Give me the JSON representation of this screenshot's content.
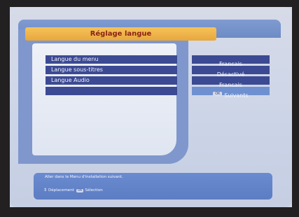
{
  "title": "Réglage langue",
  "menu": [
    {
      "label": "Langue du menu"
    },
    {
      "label": "Langue sous-titres"
    },
    {
      "label": "Langue Audio"
    },
    {
      "label": ""
    }
  ],
  "options": [
    {
      "label": "Français"
    },
    {
      "label": "Désactivé"
    },
    {
      "label": "Français"
    },
    {
      "label": "Suivants",
      "icon": "ok-button-icon"
    }
  ],
  "info": {
    "message": "Aller dans le Menu d'installation suivant.",
    "nav_label": "Déplacement",
    "ok_key": "OK",
    "select_label": "Sélection"
  },
  "colors": {
    "title_bar": "#f0b84e",
    "title_text": "#8b2314",
    "row": "#3c4a93",
    "row_selected": "#6f90d0",
    "panel": "#7f97cc"
  }
}
